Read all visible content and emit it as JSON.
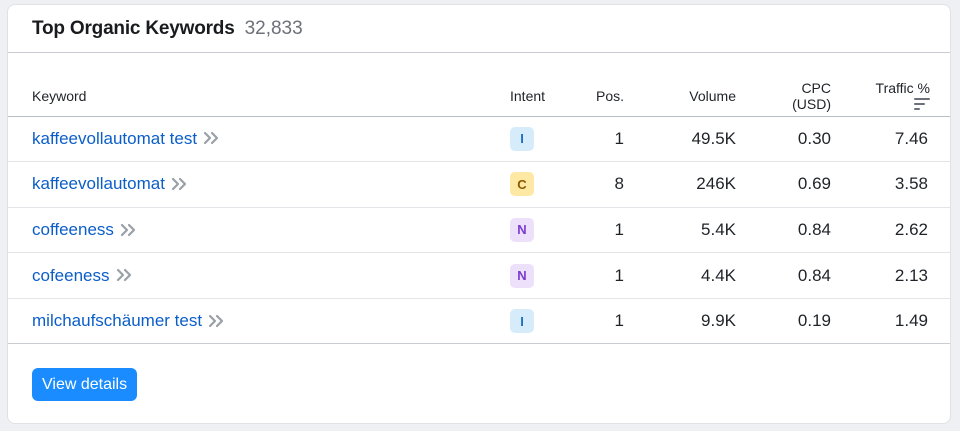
{
  "header": {
    "title": "Top Organic Keywords",
    "count": "32,833"
  },
  "columns": {
    "keyword": "Keyword",
    "intent": "Intent",
    "position": "Pos.",
    "volume": "Volume",
    "cpc": "CPC (USD)",
    "traffic": "Traffic %"
  },
  "rows": [
    {
      "keyword": "kaffeevollautomat test",
      "intent": "I",
      "intent_color": "#d6ecfb",
      "intent_text": "#1d6fc0",
      "position": "1",
      "volume": "49.5K",
      "cpc": "0.30",
      "traffic": "7.46"
    },
    {
      "keyword": "kaffeevollautomat",
      "intent": "C",
      "intent_color": "#fde9a3",
      "intent_text": "#8a5a00",
      "position": "8",
      "volume": "246K",
      "cpc": "0.69",
      "traffic": "3.58"
    },
    {
      "keyword": "coffeeness",
      "intent": "N",
      "intent_color": "#ede0fb",
      "intent_text": "#7a3bd1",
      "position": "1",
      "volume": "5.4K",
      "cpc": "0.84",
      "traffic": "2.62"
    },
    {
      "keyword": "cofeeness",
      "intent": "N",
      "intent_color": "#ede0fb",
      "intent_text": "#7a3bd1",
      "position": "1",
      "volume": "4.4K",
      "cpc": "0.84",
      "traffic": "2.13"
    },
    {
      "keyword": "milchaufschäumer test",
      "intent": "I",
      "intent_color": "#d6ecfb",
      "intent_text": "#1d6fc0",
      "position": "1",
      "volume": "9.9K",
      "cpc": "0.19",
      "traffic": "1.49"
    }
  ],
  "footer": {
    "button_label": "View details"
  },
  "icons": {
    "row_action": "double-chevron-right-icon",
    "sort": "sort-icon"
  }
}
